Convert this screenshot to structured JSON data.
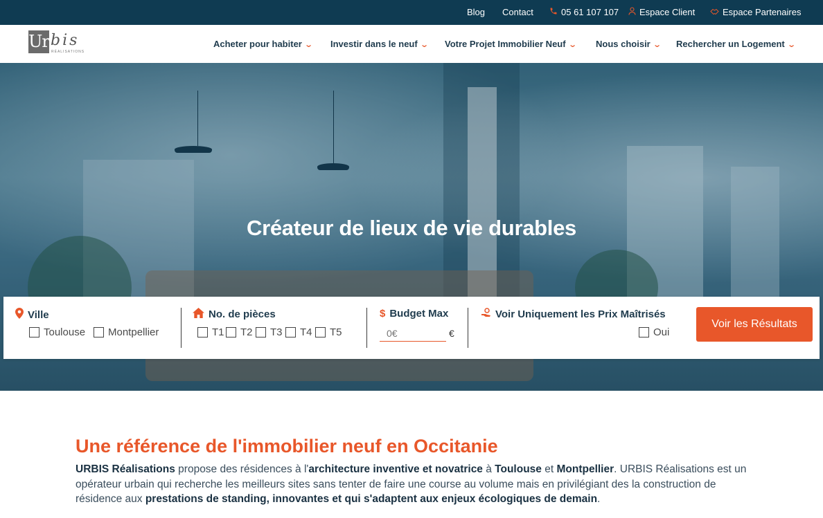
{
  "topbar": {
    "blog": "Blog",
    "contact": "Contact",
    "phone": "05 61 107 107",
    "client": "Espace Client",
    "partners": "Espace Partenaires"
  },
  "logo": {
    "box": "Ur",
    "rest": "bis",
    "sub": "RÉALISATIONS"
  },
  "nav": {
    "items": [
      "Acheter pour habiter",
      "Investir dans le neuf",
      "Votre Projet Immobilier Neuf",
      "Nous choisir",
      "Rechercher un Logement"
    ]
  },
  "hero": {
    "title": "Créateur de lieux de vie durables"
  },
  "search": {
    "city_label": "Ville",
    "city_options": [
      "Toulouse",
      "Montpellier"
    ],
    "rooms_label": "No. de pièces",
    "rooms_options": [
      "T1",
      "T2",
      "T3",
      "T4",
      "T5"
    ],
    "budget_label": "Budget Max",
    "budget_placeholder": "0€",
    "budget_unit": "€",
    "prix_label": "Voir Uniquement les Prix Maîtrisés",
    "prix_option": "Oui",
    "submit": "Voir les Résultats"
  },
  "intro": {
    "title": "Une référence de l'immobilier neuf en Occitanie",
    "p1": "URBIS Réalisations",
    "p2": " propose des résidences à l'",
    "p3": "architecture inventive et novatrice",
    "p4": " à ",
    "p5": "Toulouse",
    "p6": " et ",
    "p7": "Montpellier",
    "p8": ". URBIS Réalisations est un opérateur urbain qui recherche les meilleurs sites sans tenter de faire une course au volume mais en privilégiant des la construction de résidence aux ",
    "p9": "prestations de standing, innovantes et qui s'adaptent aux enjeux écologiques de demain",
    "p10": "."
  },
  "colors": {
    "navy": "#0f3b52",
    "accent": "#e8572a",
    "text": "#1f3b4d"
  },
  "icons": [
    "phone-icon",
    "user-icon",
    "handshake-icon",
    "map-pin-icon",
    "home-icon",
    "dollar-icon",
    "hand-money-icon",
    "chevron-down-icon"
  ]
}
